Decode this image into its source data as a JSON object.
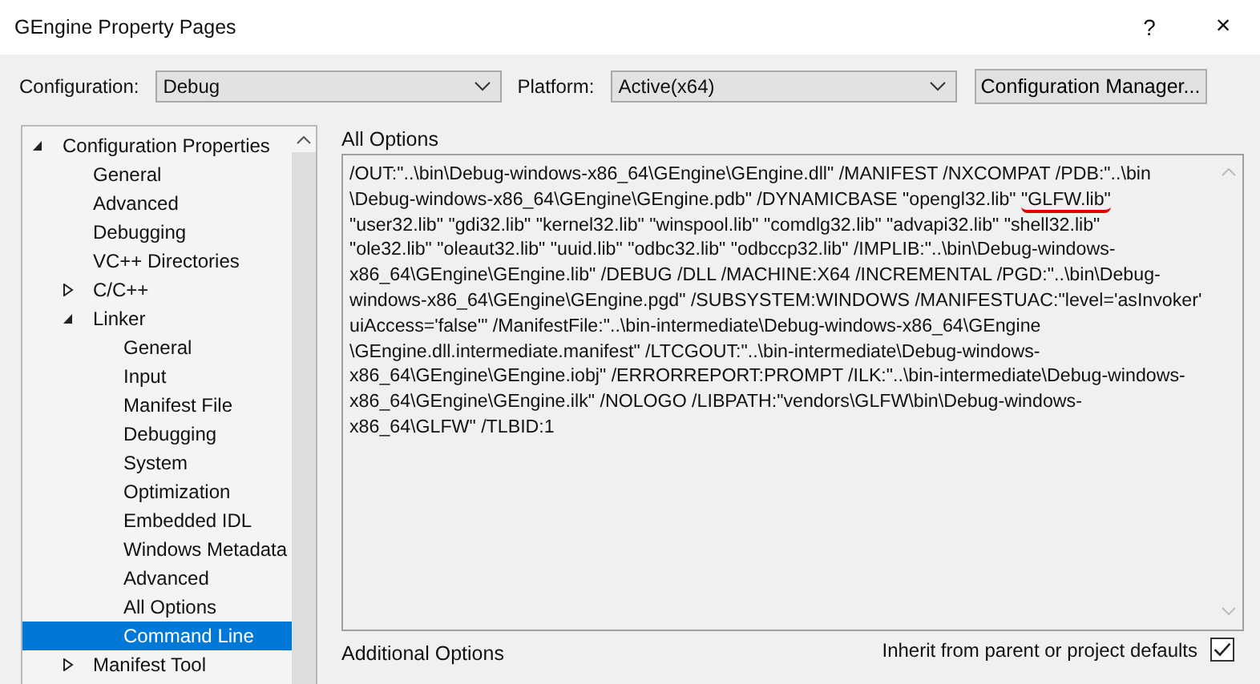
{
  "window": {
    "title": "GEngine Property Pages",
    "help": "?",
    "close": "×"
  },
  "config_bar": {
    "configuration_label": "Configuration:",
    "configuration_value": "Debug",
    "platform_label": "Platform:",
    "platform_value": "Active(x64)",
    "manager_button": "Configuration Manager..."
  },
  "tree": [
    {
      "label": "Configuration Properties",
      "expanded": true,
      "selected": false,
      "children": [
        {
          "label": "General",
          "selected": false
        },
        {
          "label": "Advanced",
          "selected": false
        },
        {
          "label": "Debugging",
          "selected": false
        },
        {
          "label": "VC++ Directories",
          "selected": false
        },
        {
          "label": "C/C++",
          "expanded": false,
          "selected": false
        },
        {
          "label": "Linker",
          "expanded": true,
          "selected": false,
          "children": [
            {
              "label": "General",
              "selected": false
            },
            {
              "label": "Input",
              "selected": false
            },
            {
              "label": "Manifest File",
              "selected": false
            },
            {
              "label": "Debugging",
              "selected": false
            },
            {
              "label": "System",
              "selected": false
            },
            {
              "label": "Optimization",
              "selected": false
            },
            {
              "label": "Embedded IDL",
              "selected": false
            },
            {
              "label": "Windows Metadata",
              "selected": false
            },
            {
              "label": "Advanced",
              "selected": false
            },
            {
              "label": "All Options",
              "selected": false
            },
            {
              "label": "Command Line",
              "selected": true
            }
          ]
        },
        {
          "label": "Manifest Tool",
          "expanded": false,
          "selected": false
        }
      ]
    }
  ],
  "all_options": {
    "label": "All Options",
    "lines": [
      [
        {
          "text": "/OUT:\"..\\bin\\Debug-windows-x86_64\\GEngine\\GEngine.dll\" /MANIFEST /NXCOMPAT /PDB:\"..\\bin",
          "marked": false
        }
      ],
      [
        {
          "text": "\\Debug-windows-x86_64\\GEngine\\GEngine.pdb\" /DYNAMICBASE \"opengl32.lib\" ",
          "marked": false
        },
        {
          "text": "\"GLFW.lib\"",
          "marked": true
        }
      ],
      [
        {
          "text": "\"user32.lib\" \"gdi32.lib\" \"kernel32.lib\" \"winspool.lib\" \"comdlg32.lib\" \"advapi32.lib\" \"shell32.lib\"",
          "marked": false
        }
      ],
      [
        {
          "text": "\"ole32.lib\" \"oleaut32.lib\" \"uuid.lib\" \"odbc32.lib\" \"odbccp32.lib\" /IMPLIB:\"..\\bin\\Debug-windows-",
          "marked": false
        }
      ],
      [
        {
          "text": "x86_64\\GEngine\\GEngine.lib\" /DEBUG /DLL /MACHINE:X64 /INCREMENTAL /PGD:\"..\\bin\\Debug-",
          "marked": false
        }
      ],
      [
        {
          "text": "windows-x86_64\\GEngine\\GEngine.pgd\" /SUBSYSTEM:WINDOWS /MANIFESTUAC:\"level='asInvoker'",
          "marked": false
        }
      ],
      [
        {
          "text": "uiAccess='false'\" /ManifestFile:\"..\\bin-intermediate\\Debug-windows-x86_64\\GEngine",
          "marked": false
        }
      ],
      [
        {
          "text": "\\GEngine.dll.intermediate.manifest\" /LTCGOUT:\"..\\bin-intermediate\\Debug-windows-",
          "marked": false
        }
      ],
      [
        {
          "text": "x86_64\\GEngine\\GEngine.iobj\" /ERRORREPORT:PROMPT /ILK:\"..\\bin-intermediate\\Debug-windows-",
          "marked": false
        }
      ],
      [
        {
          "text": "x86_64\\GEngine\\GEngine.ilk\" /NOLOGO /LIBPATH:\"vendors\\GLFW\\bin\\Debug-windows-",
          "marked": false
        }
      ],
      [
        {
          "text": "x86_64\\GLFW\" /TLBID:1",
          "marked": false
        }
      ]
    ]
  },
  "additional_options": {
    "label": "Additional Options",
    "inherit_label": "Inherit from parent or project defaults",
    "inherit_checked": true
  }
}
